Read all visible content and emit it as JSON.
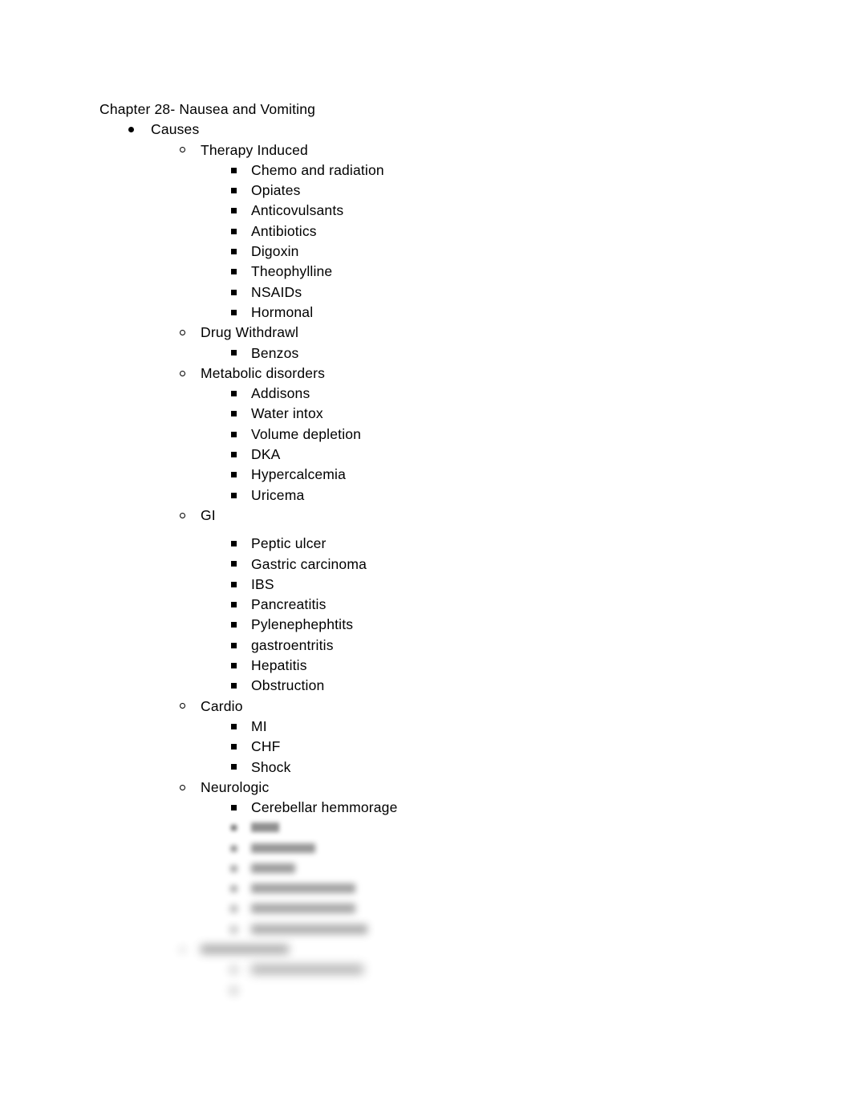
{
  "document": {
    "title": "Chapter 28- Nausea and Vomiting",
    "background_color": "#ffffff",
    "text_color": "#000000"
  },
  "markers": {
    "level1": "filled-disc",
    "level2": "hollow-circle",
    "level3": "filled-square"
  },
  "outline": {
    "causes": "Causes",
    "therapy_induced": {
      "heading": "Therapy Induced",
      "items": [
        "Chemo and radiation",
        "Opiates",
        "Anticovulsants",
        "Antibiotics",
        "Digoxin",
        "Theophylline",
        "NSAIDs",
        "Hormonal"
      ]
    },
    "drug_withdrawal": {
      "heading": "Drug Withdrawl",
      "items": [
        "Benzos"
      ]
    },
    "metabolic_disorders": {
      "heading": "Metabolic disorders",
      "items": [
        "Addisons",
        "Water intox",
        "Volume depletion",
        "DKA",
        "Hypercalcemia",
        "Uricema"
      ]
    },
    "gi": {
      "heading": "GI",
      "items": [
        "Peptic ulcer",
        "Gastric carcinoma",
        "IBS",
        "Pancreatitis",
        "Pylenephephtits",
        "gastroentritis",
        "Hepatitis",
        "Obstruction"
      ]
    },
    "cardio": {
      "heading": "Cardio",
      "items": [
        "MI",
        "CHF",
        "Shock"
      ]
    },
    "neurologic": {
      "heading": "Neurologic",
      "items": [
        "Cerebellar hemmorage"
      ]
    },
    "obscured": {
      "note": "remaining lines are blurred out in the screenshot and not legible",
      "neurologic_tail_widths": [
        35,
        80,
        55,
        130,
        130,
        145
      ],
      "section_heading_width": 110,
      "section_item_widths": [
        140,
        0
      ]
    }
  }
}
